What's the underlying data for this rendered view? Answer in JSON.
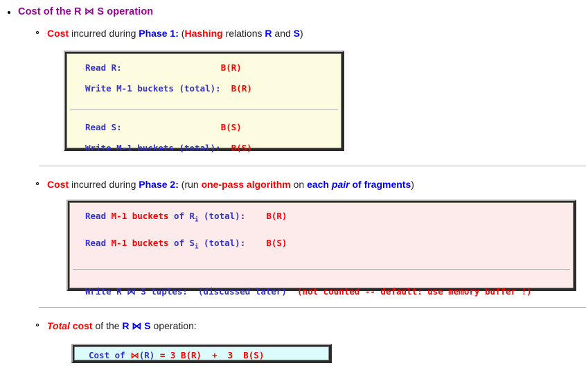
{
  "page": {
    "title": {
      "prefix": "Cost of the R ",
      "join": "⋈",
      "suffix": " S operation"
    }
  },
  "sections": [
    {
      "id": "phase1",
      "lead": {
        "t1": "Cost",
        "t2": " incurred during ",
        "t3": "Phase 1:",
        "t4": " (",
        "t5": "Hashing",
        "t6": " relations ",
        "t7": "R",
        "t8": " and ",
        "t9": "S",
        "t10": ")"
      },
      "box": {
        "style": "yellow",
        "lines": [
          {
            "blue_a": "Read R:",
            "pad": "                   ",
            "red_a": "B(R)"
          },
          {
            "blue_a": "Write M-1 buckets (total):",
            "pad": "  ",
            "red_a": "B(R)"
          },
          {
            "divider": true
          },
          {
            "blue_a": "Read S:",
            "pad": "                   ",
            "red_a": "B(S)"
          },
          {
            "blue_a": "Write M-1 buckets (total):",
            "pad": "  ",
            "red_a": "B(S)"
          }
        ]
      }
    },
    {
      "id": "phase2",
      "lead": {
        "t1": "Cost",
        "t2": " incurred during ",
        "t3": "Phase 2:",
        "t4": " (run ",
        "t5": "one-pass algorithm",
        "t6": " on ",
        "t7": "each ",
        "t8": "pair",
        "t9": " of fragments",
        "t10": ")"
      },
      "box": {
        "style": "pink",
        "lines": [
          {
            "blue_a": "Read ",
            "red_b": "M-1 buckets",
            "blue_c": " of R",
            "sub": "i",
            "blue_d": " (total):",
            "pad": "    ",
            "red_a": "B(R)"
          },
          {
            "blue_a": "Read ",
            "red_b": "M-1 buckets",
            "blue_c": " of S",
            "sub": "i",
            "blue_d": " (total):",
            "pad": "    ",
            "red_a": "B(S)"
          },
          {
            "divider": true
          },
          {
            "blue_a": "Write R ⋈ S tuples:  (discussed later)",
            "pad": "  ",
            "red_a": "(not counted -- default: use memory buffer !)"
          }
        ]
      }
    },
    {
      "id": "total",
      "lead": {
        "t1": "Total",
        "t2": " cost",
        "t3": " of the ",
        "t4": "R ⋈ S",
        "t5": " operation:"
      },
      "box": {
        "style": "cyan",
        "line": {
          "blue_a": "Cost of ",
          "red_b": "⋈",
          "blue_c": "(R) ",
          "red_d": "= 3 ",
          "blue_e": "",
          "red_f": "B(R)  +  3  B(S)"
        }
      }
    }
  ]
}
